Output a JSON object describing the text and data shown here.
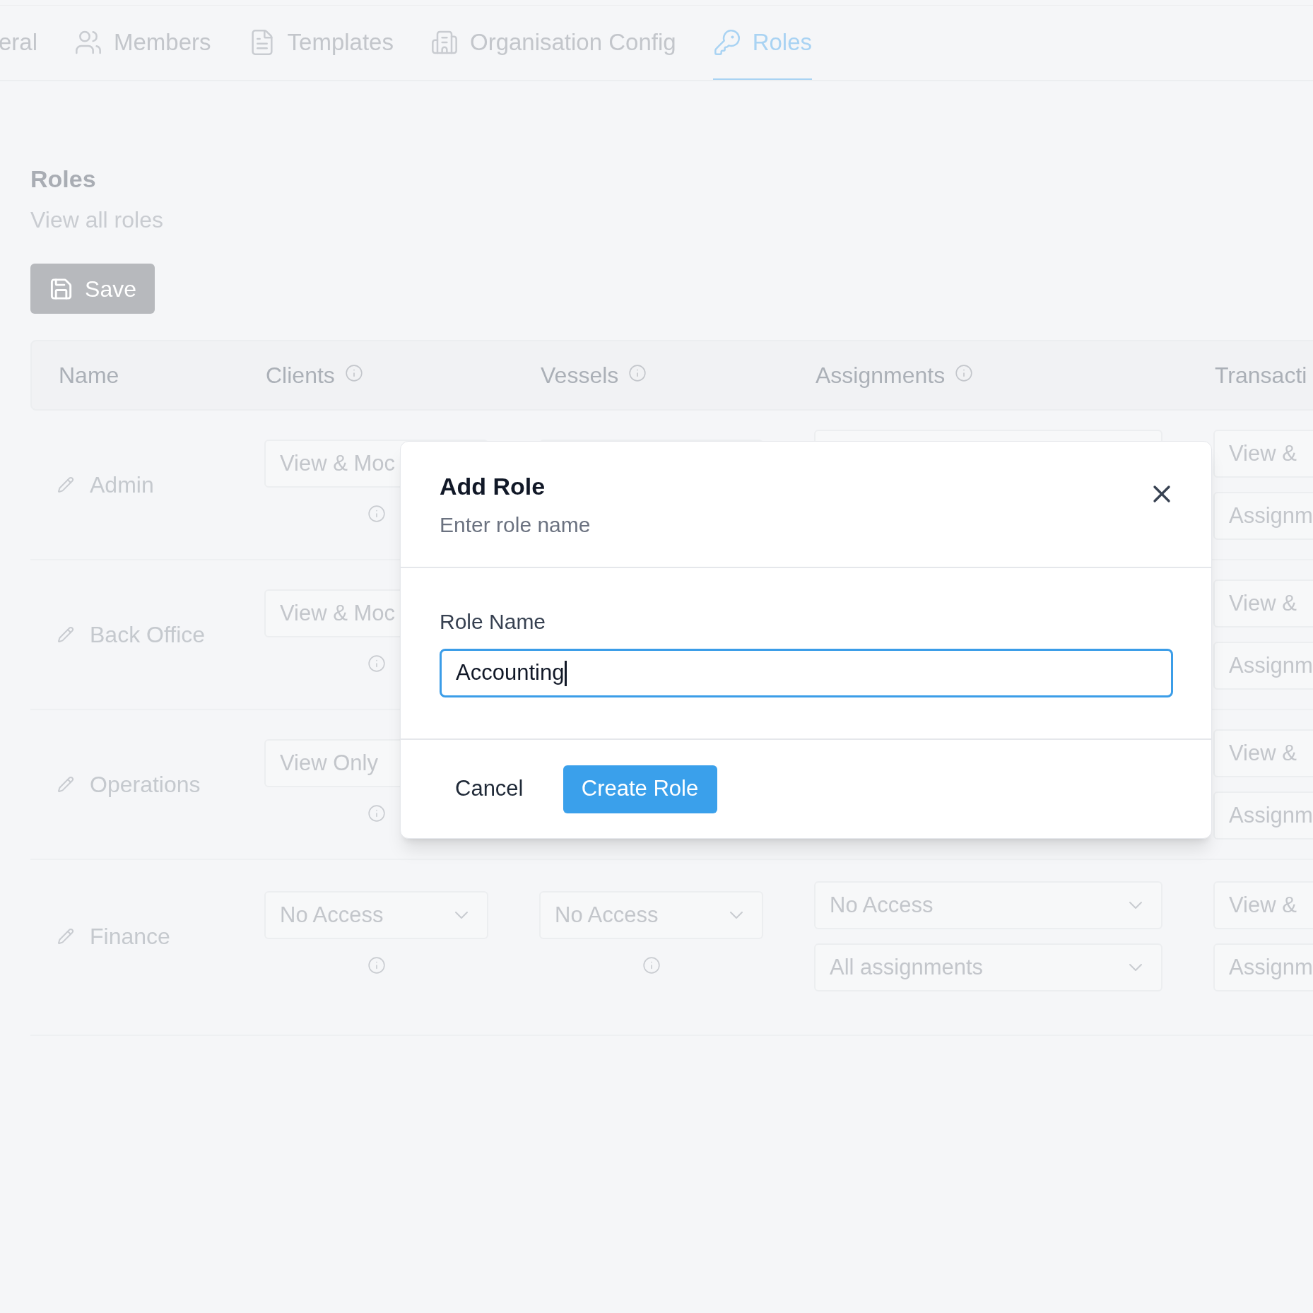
{
  "tabs": [
    {
      "label": "eral",
      "selected": false
    },
    {
      "label": "Members",
      "selected": false
    },
    {
      "label": "Templates",
      "selected": false
    },
    {
      "label": "Organisation Config",
      "selected": false
    },
    {
      "label": "Roles",
      "selected": true
    }
  ],
  "page": {
    "title": "Roles",
    "subtitle": "View all roles",
    "save_button": "Save"
  },
  "table": {
    "columns": [
      "Name",
      "Clients",
      "Vessels",
      "Assignments",
      "Transacti"
    ],
    "rows": [
      {
        "cells": [
          {
            "values": [
              "Admin"
            ]
          },
          {
            "selects": [
              {
                "value": "View & Moc"
              }
            ]
          },
          {},
          {},
          {
            "selects": [
              {
                "value": "View &"
              },
              {
                "value": "Assignm"
              }
            ]
          }
        ]
      },
      {
        "cells": [
          {
            "values": [
              "Back Office"
            ]
          },
          {
            "selects": [
              {
                "value": "View & Moc"
              }
            ]
          },
          {},
          {},
          {
            "selects": [
              {
                "value": "View &"
              },
              {
                "value": "Assignm"
              }
            ]
          }
        ]
      },
      {
        "cells": [
          {
            "values": [
              "Operations"
            ]
          },
          {
            "selects": [
              {
                "value": "View Only"
              }
            ]
          },
          {},
          {},
          {
            "selects": [
              {
                "value": "View &"
              },
              {
                "value": "Assignm"
              }
            ]
          }
        ]
      },
      {
        "cells": [
          {
            "values": [
              "Finance"
            ]
          },
          {
            "selects": [
              {
                "value": "No Access",
                "chevron": true
              }
            ]
          },
          {
            "selects": [
              {
                "value": "No Access",
                "chevron": true
              }
            ]
          },
          {
            "selects": [
              {
                "value": "No Access",
                "chevron": true
              },
              {
                "value": "All assignments",
                "chevron": true
              }
            ]
          },
          {
            "selects": [
              {
                "value": "View &"
              },
              {
                "value": "Assignm"
              }
            ]
          }
        ]
      }
    ]
  },
  "dialog": {
    "title": "Add Role",
    "subtitle": "Enter role name",
    "field_label": "Role Name",
    "field_value": "Accounting",
    "cancel_button": "Cancel",
    "create_button": "Create Role"
  }
}
